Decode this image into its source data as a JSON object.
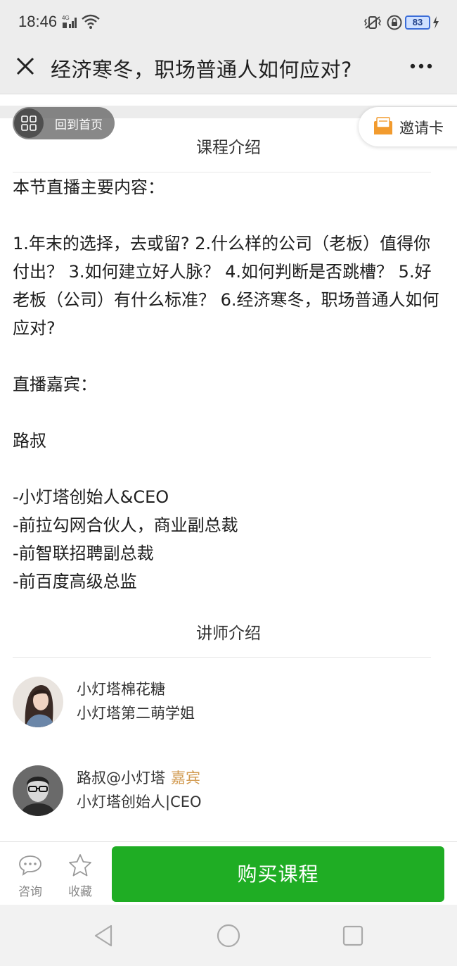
{
  "status_bar": {
    "time": "18:46",
    "network_label": "4G",
    "battery": "83",
    "icons": [
      "signal-icon",
      "wifi-icon",
      "vibrate-icon",
      "rotation-lock-icon",
      "battery-icon",
      "charging-icon"
    ]
  },
  "header": {
    "title": "经济寒冬，职场普通人如何应对?",
    "close_icon": "close-icon",
    "more_icon": "more-icon"
  },
  "floating": {
    "home_label": "回到首页",
    "invite_label": "邀请卡"
  },
  "course_intro": {
    "title": "课程介绍",
    "paragraphs": [
      "本节直播主要内容：",
      "",
      "1.年末的选择，去或留? 2.什么样的公司（老板）值得你付出？ 3.如何建立好人脉？ 4.如何判断是否跳槽？ 5.好老板（公司）有什么标准？ 6.经济寒冬，职场普通人如何应对?",
      "",
      "直播嘉宾：",
      "",
      "路叔",
      "",
      "-小灯塔创始人&CEO",
      "-前拉勾网合伙人，商业副总裁",
      "-前智联招聘副总裁",
      "-前百度高级总监"
    ]
  },
  "teacher_intro": {
    "title": "讲师介绍",
    "teachers": [
      {
        "name": "小灯塔棉花糖",
        "badge": "",
        "desc": "小灯塔第二萌学姐"
      },
      {
        "name": "路叔@小灯塔",
        "badge": "嘉宾",
        "desc": "小灯塔创始人|CEO"
      }
    ]
  },
  "bottom_bar": {
    "consult_label": "咨询",
    "favorite_label": "收藏",
    "buy_label": "购买课程"
  },
  "colors": {
    "buy_button": "#1fad24",
    "badge": "#d29b52",
    "invite_icon": "#f29b2e"
  }
}
